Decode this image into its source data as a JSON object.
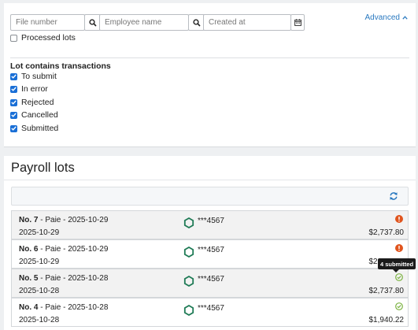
{
  "filters": {
    "file_number_placeholder": "File number",
    "employee_name_placeholder": "Employee name",
    "created_at_placeholder": "Created at",
    "advanced_label": "Advanced",
    "processed_lots_label": "Processed lots",
    "processed_lots_checked": false
  },
  "transactions": {
    "title": "Lot contains transactions",
    "options": [
      {
        "label": "To submit",
        "checked": true
      },
      {
        "label": "In error",
        "checked": true
      },
      {
        "label": "Rejected",
        "checked": true
      },
      {
        "label": "Cancelled",
        "checked": true
      },
      {
        "label": "Submitted",
        "checked": true
      }
    ]
  },
  "lots": {
    "title": "Payroll lots",
    "rows": [
      {
        "no": "No. 7",
        "desc": " - Paie - 2025-10-29",
        "date": "2025-10-29",
        "account": "***4567",
        "status": "error",
        "amount": "$2,737.80"
      },
      {
        "no": "No. 6",
        "desc": " - Paie - 2025-10-29",
        "date": "2025-10-29",
        "account": "***4567",
        "status": "error",
        "amount": "$2,737.80"
      },
      {
        "no": "No. 5",
        "desc": " - Paie - 2025-10-28",
        "date": "2025-10-28",
        "account": "***4567",
        "status": "submitted",
        "amount": "$2,737.80"
      },
      {
        "no": "No. 4",
        "desc": " - Paie - 2025-10-28",
        "date": "2025-10-28",
        "account": "***4567",
        "status": "submitted",
        "amount": "$1,940.22"
      }
    ],
    "tooltip": "4 submitted"
  },
  "colors": {
    "accent": "#2a79c0",
    "checkbox": "#1a6fd6",
    "error": "#e0541d",
    "success": "#7cb342",
    "hexagon": "#1e7a55"
  }
}
